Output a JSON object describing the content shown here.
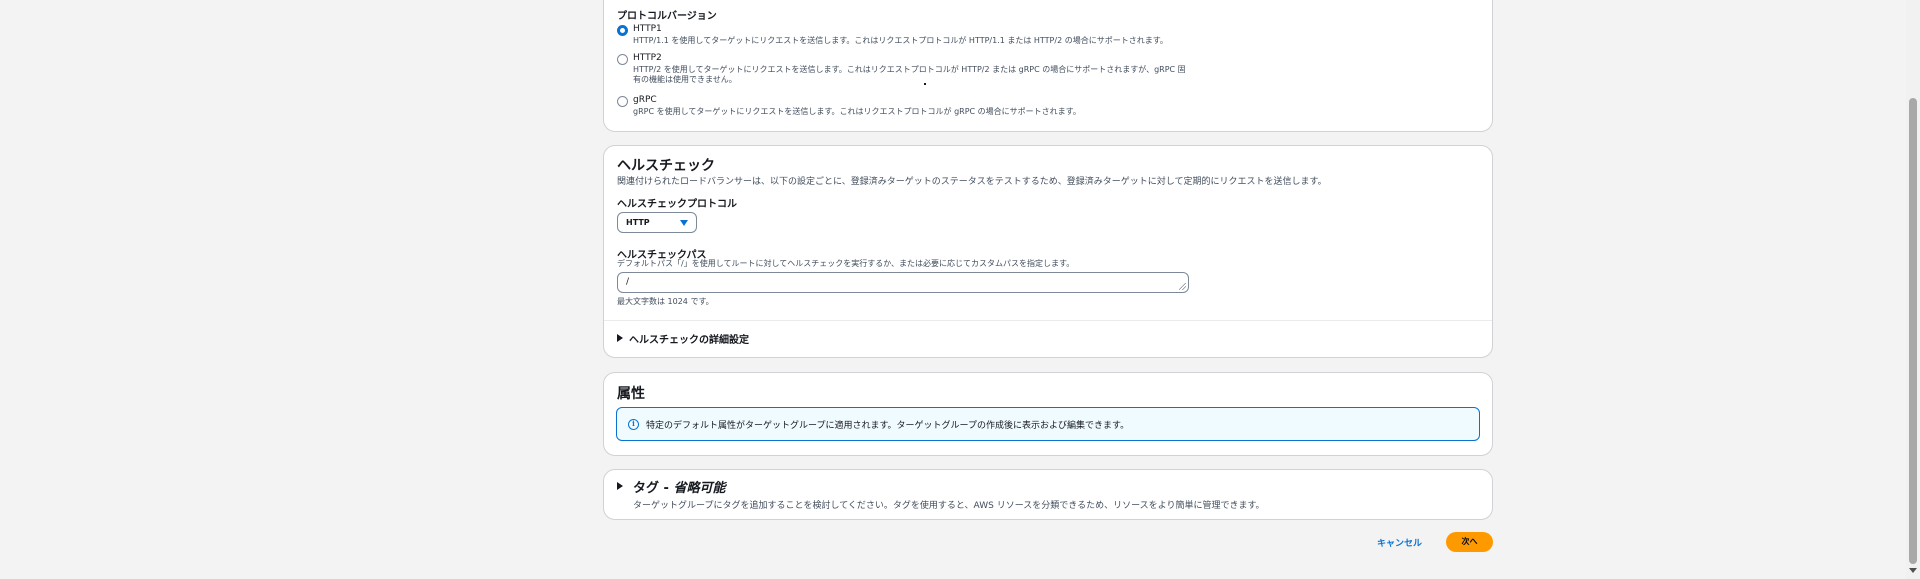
{
  "protocol_section": {
    "label": "プロトコルバージョン",
    "options": [
      {
        "title": "HTTP1",
        "description": "HTTP/1.1 を使用してターゲットにリクエストを送信します。これはリクエストプロトコルが HTTP/1.1 または HTTP/2 の場合にサポートされます。",
        "selected": true
      },
      {
        "title": "HTTP2",
        "description": "HTTP/2 を使用してターゲットにリクエストを送信します。これはリクエストプロトコルが HTTP/2 または gRPC の場合にサポートされますが、gRPC 固",
        "description_line2": "有の機能は使用できません。",
        "selected": false
      },
      {
        "title": "gRPC",
        "description": "gRPC を使用してターゲットにリクエストを送信します。これはリクエストプロトコルが gRPC の場合にサポートされます。",
        "selected": false
      }
    ]
  },
  "health_check": {
    "title": "ヘルスチェック",
    "description": "関連付けられたロードバランサーは、以下の設定ごとに、登録済みターゲットのステータスをテストするため、登録済みターゲットに対して定期的にリクエストを送信します。",
    "protocol_label": "ヘルスチェックプロトコル",
    "protocol_value": "HTTP",
    "path_label": "ヘルスチェックパス",
    "path_description": "デフォルトパス「/」を使用してルートに対してヘルスチェックを実行するか、または必要に応じてカスタムパスを指定します。",
    "path_value": "/",
    "path_hint": "最大文字数は 1024 です。",
    "advanced_label": "ヘルスチェックの詳細設定"
  },
  "attributes": {
    "title": "属性",
    "info_icon": "info-icon",
    "info_text": "特定のデフォルト属性がターゲットグループに適用されます。ターゲットグループの作成後に表示および編集できます。"
  },
  "tags": {
    "title": "タグ - ",
    "title_optional": "省略可能",
    "description": "ターゲットグループにタグを追加することを検討してください。タグを使用すると、AWS リソースを分類できるため、リソースをより簡単に管理できます。"
  },
  "actions": {
    "cancel_label": "キャンセル",
    "next_label": "次へ"
  },
  "colors": {
    "accent": "#0972d3",
    "primary_button": "#ff9900",
    "info_background": "#f0fbff"
  }
}
